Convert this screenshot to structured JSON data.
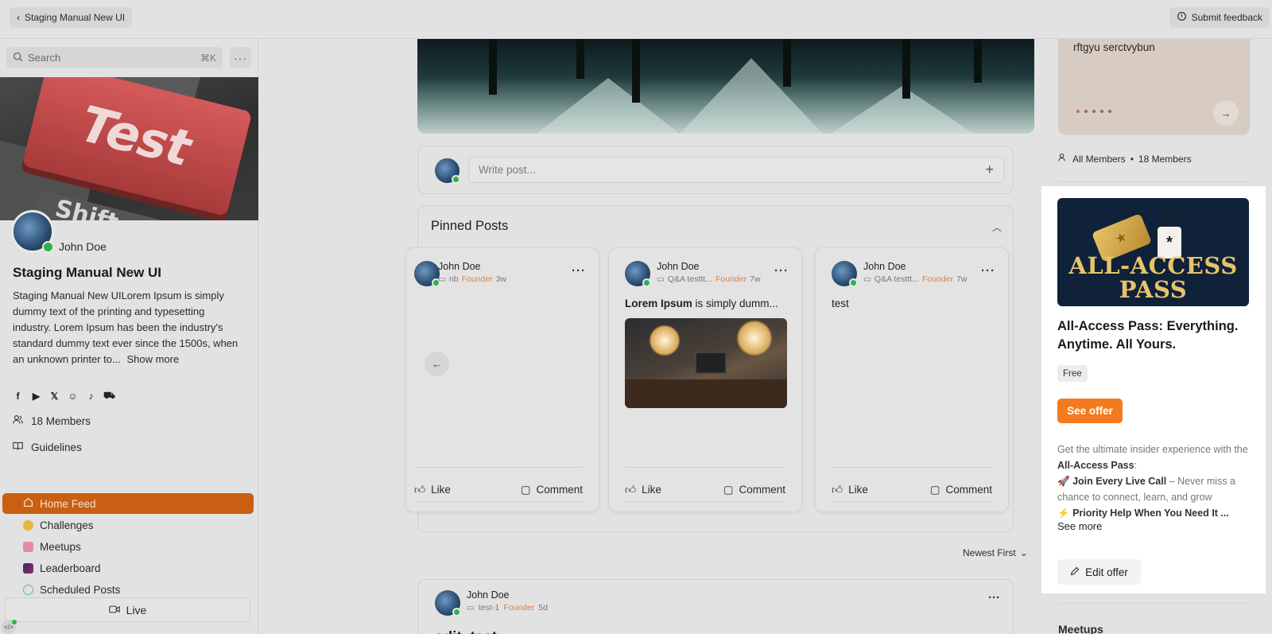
{
  "topbar": {
    "back_label": "Staging Manual New UI",
    "feedback_label": "Submit feedback"
  },
  "sidebar": {
    "search_placeholder": "Search",
    "search_shortcut": "⌘K",
    "cover_key_text": "Test",
    "cover_shift_text": "Shift",
    "owner_name": "John Doe",
    "community_title": "Staging Manual New UI",
    "description": "Staging Manual New UILorem Ipsum is simply dummy text of the printing and typesetting industry. Lorem Ipsum has been the industry's standard dummy text ever since the 1500s, when an unknown printer to...",
    "show_more": "Show more",
    "socials": [
      "facebook-icon",
      "youtube-icon",
      "x-icon",
      "snapchat-icon",
      "tiktok-icon",
      "shop-icon"
    ],
    "members_label": "18 Members",
    "guidelines_label": "Guidelines",
    "nav": [
      {
        "label": "Home Feed",
        "icon": "home-icon",
        "active": true
      },
      {
        "label": "Challenges",
        "icon": "smiley-icon",
        "active": false
      },
      {
        "label": "Meetups",
        "icon": "calendar-icon",
        "active": false
      },
      {
        "label": "Leaderboard",
        "icon": "leaderboard-icon",
        "active": false
      },
      {
        "label": "Scheduled Posts",
        "icon": "check-circle-icon",
        "active": false
      }
    ],
    "live_label": "Live"
  },
  "composer": {
    "placeholder": "Write post..."
  },
  "pinned": {
    "title": "Pinned Posts",
    "posts": [
      {
        "author": "John Doe",
        "space": "nb",
        "role": "Founder",
        "time": "3w",
        "text_bold": "",
        "text": "",
        "has_image": false,
        "like": "Like",
        "comment": "Comment"
      },
      {
        "author": "John Doe",
        "space": "Q&A testtt...",
        "role": "Founder",
        "time": "7w",
        "text_bold": "Lorem Ipsum",
        "text": " is simply dumm...",
        "has_image": true,
        "like": "Like",
        "comment": "Comment"
      },
      {
        "author": "John Doe",
        "space": "Q&A testtt...",
        "role": "Founder",
        "time": "7w",
        "text_bold": "",
        "text": "test",
        "has_image": false,
        "like": "Like",
        "comment": "Comment"
      }
    ]
  },
  "feed": {
    "sort_label": "Newest First",
    "post": {
      "author": "John Doe",
      "space": "test-1",
      "role": "Founder",
      "time": "5d",
      "title": "edit_test"
    }
  },
  "right": {
    "slide_text": "rftgyu serctvybun",
    "slide_count": 5,
    "slide_active": 0,
    "members_scope": "All Members",
    "members_count": "18 Members",
    "offer": {
      "image_brand": "ALL-ACCESS PASS",
      "title": "All-Access Pass: Everything. Anytime. All Yours.",
      "price": "Free",
      "cta": "See offer",
      "desc_intro": "Get the ultimate insider experience with the",
      "desc_bold": "All-Access Pass",
      "desc_line1_emoji": "🚀",
      "desc_line1_bold": "Join Every Live Call",
      "desc_line1_rest": " – Never miss a chance to connect, learn, and grow",
      "desc_line2_emoji": "⚡",
      "desc_line2_bold": "Priority Help When You Need It ...",
      "see_more": "See more",
      "edit": "Edit offer"
    },
    "meetups_heading": "Meetups"
  },
  "colors": {
    "accent": "#f47a1f",
    "active_nav": "#c95f12",
    "online": "#2bb34a",
    "founder": "#d9824a"
  }
}
